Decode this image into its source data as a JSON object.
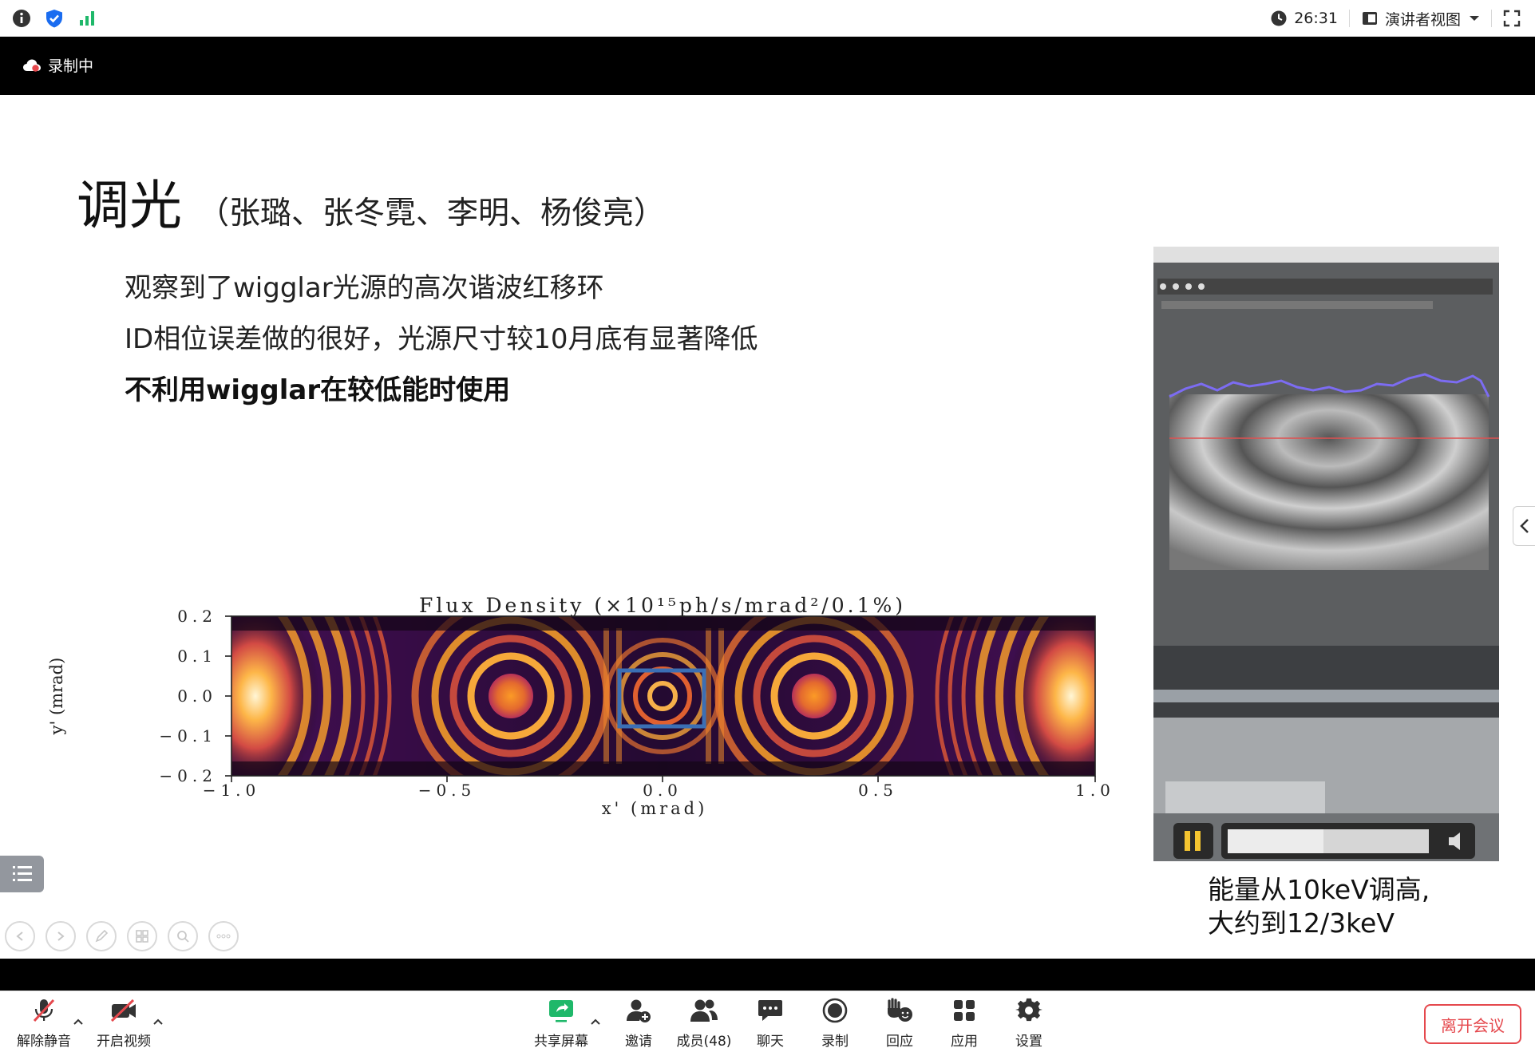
{
  "top_bar": {
    "timer": "26:31",
    "view_mode": "演讲者视图"
  },
  "recording": {
    "label": "录制中"
  },
  "slide": {
    "title": "调光",
    "title_authors": "（张璐、张冬霓、李明、杨俊亮）",
    "bullets": [
      {
        "text": "观察到了wigglar光源的高次谐波红移环",
        "bold": false
      },
      {
        "text": "ID相位误差做的很好，光源尺寸较10月底有显著降低",
        "bold": false
      },
      {
        "text": "不利用wigglar在较低能时使用",
        "bold": true
      }
    ],
    "plot": {
      "title": "Flux Density (×10¹⁵ph/s/mrad²/0.1%)",
      "xlabel": "x' (mrad)",
      "ylabel": "y' (mrad)",
      "x_ticks": [
        "−1.0",
        "−0.5",
        "0.0",
        "0.5",
        "1.0"
      ],
      "y_ticks": [
        "0.2",
        "0.1",
        "0.0",
        "−0.1",
        "−0.2"
      ]
    },
    "video_caption_line1": "能量从10keV调高,",
    "video_caption_line2": "大约到12/3keV"
  },
  "toolbar": {
    "unmute": "解除静音",
    "start_video": "开启视频",
    "share_screen": "共享屏幕",
    "invite": "邀请",
    "members": "成员(48)",
    "chat": "聊天",
    "record": "录制",
    "reactions": "回应",
    "apps": "应用",
    "settings": "设置",
    "leave": "离开会议"
  },
  "colors": {
    "accent_green": "#1fb86a",
    "leave_red": "#e5484d",
    "blue_icon": "#1a6cf0",
    "marker_blue": "#3b6fb5"
  }
}
